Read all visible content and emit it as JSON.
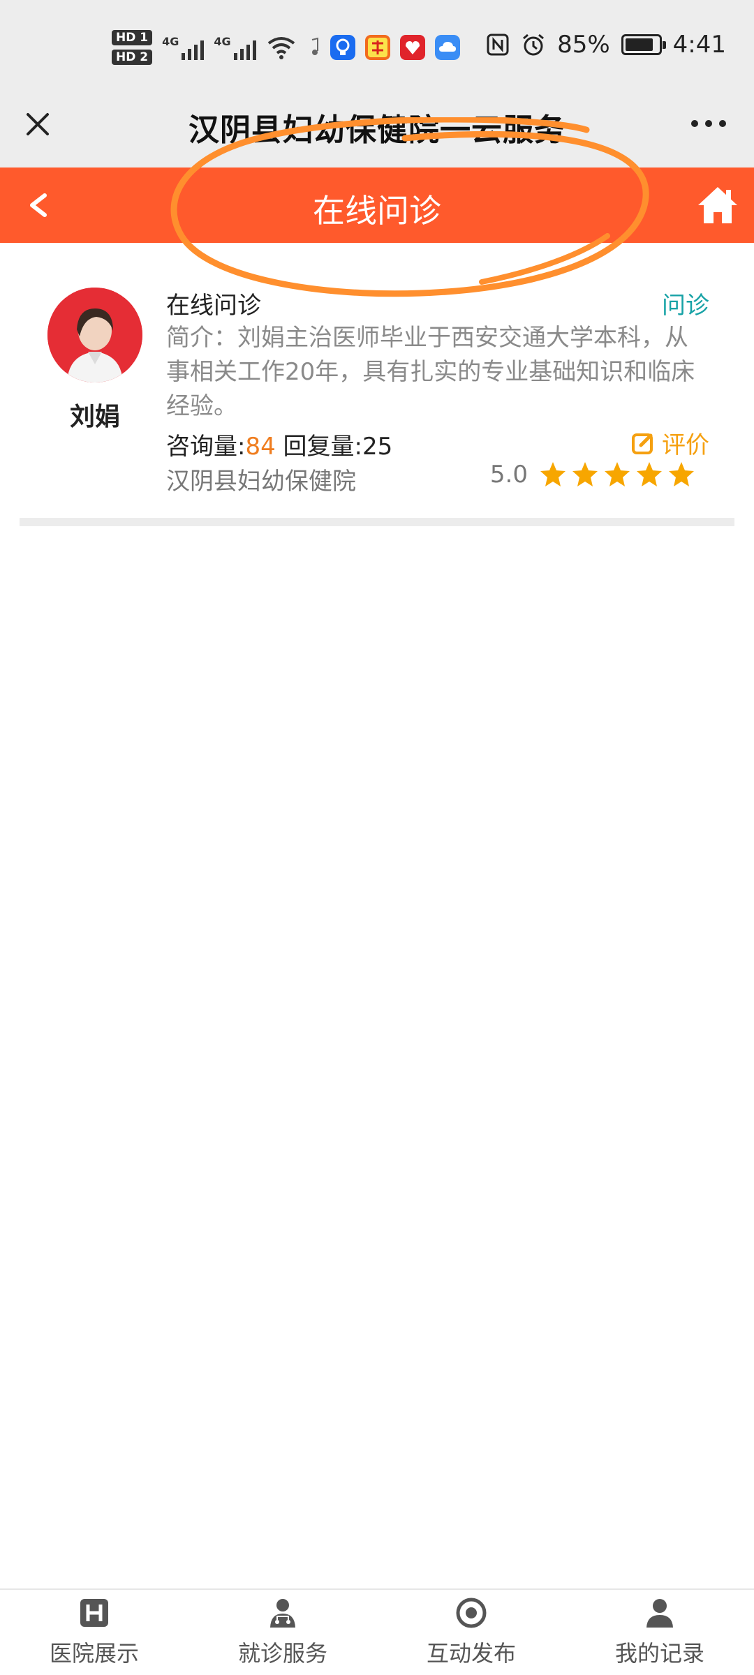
{
  "status_bar": {
    "hd1": "HD 1",
    "hd2": "HD 2",
    "net1": "4G",
    "net2": "4G",
    "battery": "85%",
    "battery_level": 0.85,
    "time": "4:41"
  },
  "wechat_bar": {
    "title": "汉阴县妇幼保健院一云服务"
  },
  "page_header": {
    "title": "在线问诊",
    "back_label": "<",
    "accent_color": "#ff5a2c"
  },
  "doctor": {
    "name": "刘娟",
    "service_title": "在线问诊",
    "service_tag": "问诊",
    "intro": "简介：刘娟主治医师毕业于西安交通大学本科，从事相关工作20年，具有扎实的专业基础知识和临床经验。",
    "consult_label": "咨询量:",
    "consult_count": "84",
    "reply_label": "回复量:",
    "reply_count": "25",
    "review_label": "评价",
    "hospital": "汉阴县妇幼保健院",
    "rating": "5.0",
    "stars": 5
  },
  "tabbar": {
    "items": [
      {
        "label": "医院展示",
        "icon": "hospital-icon"
      },
      {
        "label": "就诊服务",
        "icon": "doctor-icon"
      },
      {
        "label": "互动发布",
        "icon": "target-icon"
      },
      {
        "label": "我的记录",
        "icon": "user-icon"
      }
    ]
  }
}
